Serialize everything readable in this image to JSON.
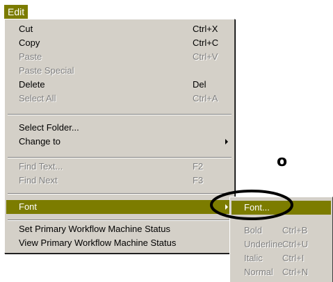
{
  "menubar": {
    "edit_label": "Edit",
    "edit_mnemonic": "E"
  },
  "menu": {
    "items": [
      {
        "label": "Cut",
        "accel": "Ctrl+X",
        "enabled": true
      },
      {
        "label": "Copy",
        "accel": "Ctrl+C",
        "enabled": true
      },
      {
        "label": "Paste",
        "accel": "Ctrl+V",
        "enabled": false
      },
      {
        "label": "Paste Special",
        "accel": "",
        "enabled": false
      },
      {
        "label": "Delete",
        "accel": "Del",
        "enabled": true
      },
      {
        "label": "Select All",
        "accel": "Ctrl+A",
        "enabled": false
      },
      {
        "label": "Select Folder...",
        "accel": "",
        "enabled": true
      },
      {
        "label": "Change to",
        "accel": "",
        "enabled": true,
        "submenu": true
      },
      {
        "label": "Find Text...",
        "accel": "F2",
        "enabled": false
      },
      {
        "label": "Find Next",
        "accel": "F3",
        "enabled": false
      },
      {
        "label": "Font",
        "accel": "",
        "enabled": true,
        "submenu": true,
        "selected": true
      },
      {
        "label": "Set Primary Workflow Machine Status",
        "accel": "",
        "enabled": true
      },
      {
        "label": "View Primary Workflow Machine Status",
        "accel": "",
        "enabled": true
      }
    ]
  },
  "submenu": {
    "items": [
      {
        "label": "Font...",
        "accel": "",
        "enabled": true,
        "selected": true
      },
      {
        "label": "Bold",
        "accel": "Ctrl+B",
        "enabled": false
      },
      {
        "label": "Underline",
        "accel": "Ctrl+U",
        "enabled": false
      },
      {
        "label": "Italic",
        "accel": "Ctrl+I",
        "enabled": false
      },
      {
        "label": "Normal",
        "accel": "Ctrl+N",
        "enabled": false
      }
    ]
  },
  "annotation": {
    "text": "o"
  },
  "colors": {
    "highlight": "#7c7c00",
    "menu_bg": "#d4d0c8",
    "disabled_text": "#808080"
  }
}
